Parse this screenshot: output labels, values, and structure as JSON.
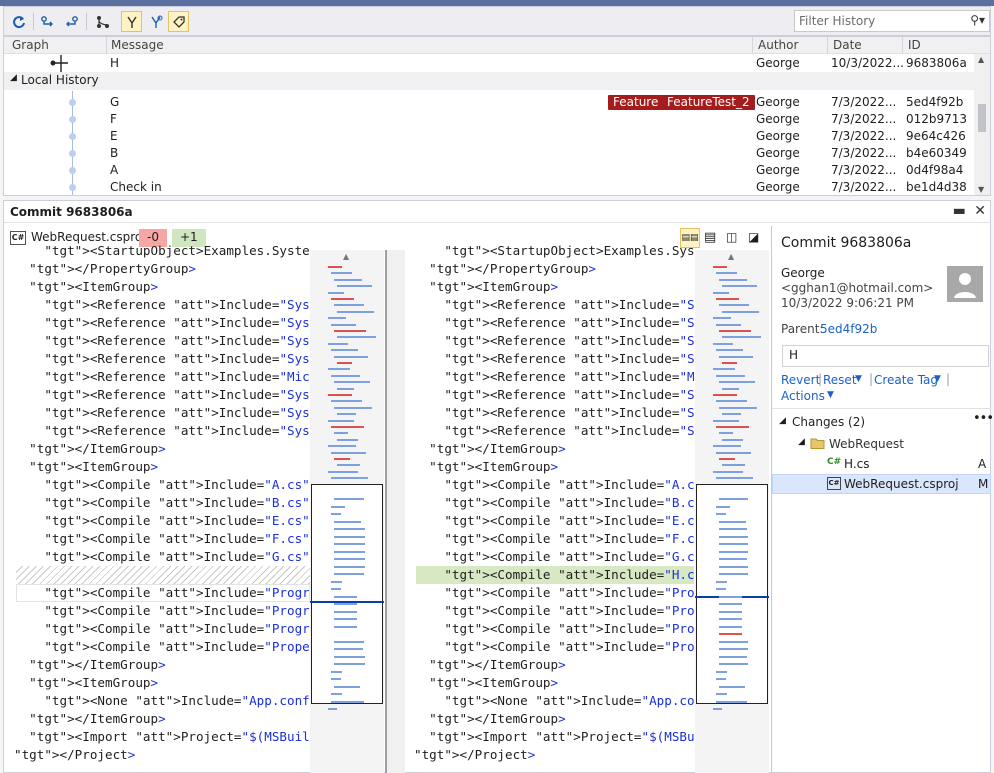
{
  "toolbar": {
    "filter_placeholder": "Filter History"
  },
  "history": {
    "columns": {
      "graph": "Graph",
      "message": "Message",
      "author": "Author",
      "date": "Date",
      "id": "ID"
    },
    "top_row": {
      "message": "H",
      "author": "George",
      "date": "10/3/2022...",
      "id": "9683806a"
    },
    "local_history_label": "Local History",
    "rows": [
      {
        "message": "G",
        "author": "George",
        "date": "7/3/2022...",
        "id": "5ed4f92b"
      },
      {
        "message": "F",
        "author": "George",
        "date": "7/3/2022...",
        "id": "012b9713"
      },
      {
        "message": "E",
        "author": "George",
        "date": "7/3/2022...",
        "id": "9e64c426"
      },
      {
        "message": "B",
        "author": "George",
        "date": "7/3/2022...",
        "id": "b4e60349"
      },
      {
        "message": "A",
        "author": "George",
        "date": "7/3/2022...",
        "id": "0d4f98a4"
      },
      {
        "message": "Check in",
        "author": "George",
        "date": "7/3/2022...",
        "id": "be1d4d38"
      }
    ],
    "tags": [
      "Feature",
      "FeatureTest_2"
    ]
  },
  "commit_pane": {
    "title": "Commit 9683806a",
    "file_name": "WebRequest.csproj",
    "removed": "-0",
    "added": "+1",
    "file_icon_label": "C#"
  },
  "diff_left": [
    "    <StartupObject>Examples.System.Net",
    "  </PropertyGroup>",
    "  <ItemGroup>",
    "    <Reference Include=\"System\" />",
    "    <Reference Include=\"System.Core\" />",
    "    <Reference Include=\"System.Xml.Linq",
    "    <Reference Include=\"System.Data.Dat",
    "    <Reference Include=\"Microsoft.CShar",
    "    <Reference Include=\"System.Data\" />",
    "    <Reference Include=\"System.Net.Http",
    "    <Reference Include=\"System.Xml\" />",
    "  </ItemGroup>",
    "  <ItemGroup>",
    "    <Compile Include=\"A.cs\" />",
    "    <Compile Include=\"B.cs\" />",
    "    <Compile Include=\"E.cs\" />",
    "    <Compile Include=\"F.cs\" />",
    "    <Compile Include=\"G.cs\" />",
    "",
    "    <Compile Include=\"ProgramAsync.cs\"",
    "    <Compile Include=\"ProgramPost.cs\" ",
    "    <Compile Include=\"ProgramGet.cs\" />",
    "    <Compile Include=\"Properties\\Assemb",
    "  </ItemGroup>",
    "  <ItemGroup>",
    "    <None Include=\"App.config\" />",
    "  </ItemGroup>",
    "  <Import Project=\"$(MSBuildToolsPath)\"",
    "</Project>"
  ],
  "diff_right": [
    "    <StartupObject>Examples.System.Ne",
    "  </PropertyGroup>",
    "  <ItemGroup>",
    "    <Reference Include=\"System\" />",
    "    <Reference Include=\"System.Core\"",
    "    <Reference Include=\"System.Xml.Li",
    "    <Reference Include=\"System.Data.D",
    "    <Reference Include=\"Microsoft.CSh",
    "    <Reference Include=\"System.Data\"",
    "    <Reference Include=\"System.Net.Ht",
    "    <Reference Include=\"System.Xml\" /",
    "  </ItemGroup>",
    "  <ItemGroup>",
    "    <Compile Include=\"A.cs\" />",
    "    <Compile Include=\"B.cs\" />",
    "    <Compile Include=\"E.cs\" />",
    "    <Compile Include=\"F.cs\" />",
    "    <Compile Include=\"G.cs\" />",
    "    <Compile Include=\"H.cs\" />",
    "    <Compile Include=\"ProgramAsync.cs",
    "    <Compile Include=\"ProgramPost.cs\"",
    "    <Compile Include=\"ProgramGet.cs\"",
    "    <Compile Include=\"Properties\\Asse",
    "  </ItemGroup>",
    "  <ItemGroup>",
    "    <None Include=\"App.config\" />",
    "  </ItemGroup>",
    "  <Import Project=\"$(MSBuildToolsPath",
    "</Project>"
  ],
  "side": {
    "title": "Commit 9683806a",
    "author": "George",
    "email": "<gghan1@hotmail.com>",
    "date": "10/3/2022 9:06:21 PM",
    "parent_label": "Parent:",
    "parent_id": "5ed4f92b",
    "message": "H",
    "revert": "Revert",
    "reset": "Reset",
    "create_tag": "Create Tag",
    "actions": "Actions",
    "changes_label": "Changes (2)",
    "folder": "WebRequest",
    "files": [
      {
        "name": "H.cs",
        "status": "A",
        "icon": "C#"
      },
      {
        "name": "WebRequest.csproj",
        "status": "M",
        "icon": "C#"
      }
    ]
  },
  "colors": {
    "accent": "#5b6fa0",
    "tag": "#a51c1c",
    "added_line": "#d7e8c3",
    "removed_badge": "#f7a6a6",
    "added_badge": "#cfe6c0",
    "link": "#1a62c8",
    "selection": "#d9e6fb"
  }
}
